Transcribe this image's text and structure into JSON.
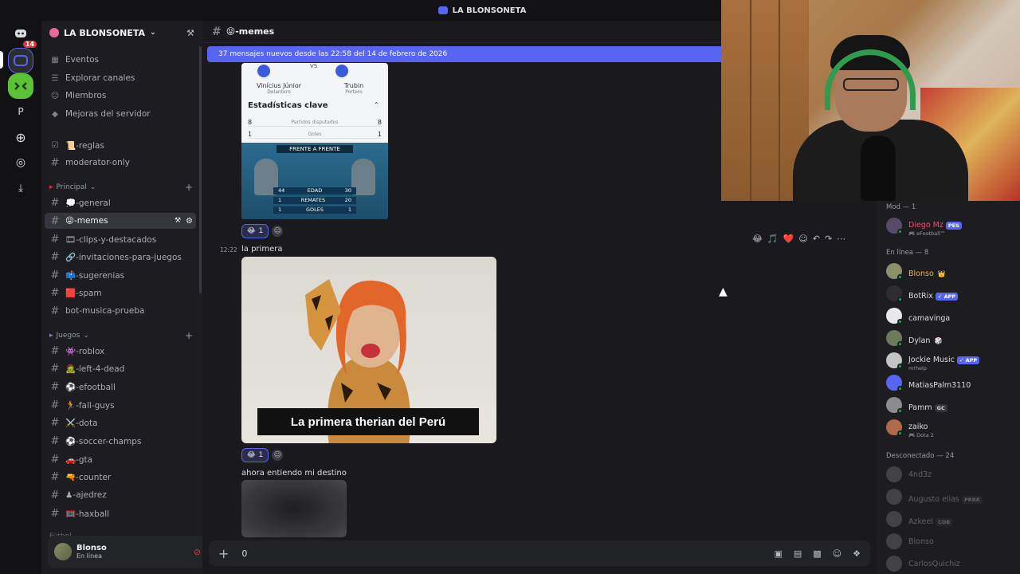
{
  "window": {
    "title": "LA BLONSONETA"
  },
  "rail": {
    "badge": "14",
    "p_label": "P"
  },
  "server": {
    "name": "LA BLONSONETA"
  },
  "sidebar": {
    "top_items": [
      {
        "label": "Eventos"
      },
      {
        "label": "Explorar canales"
      },
      {
        "label": "Miembros"
      },
      {
        "label": "Mejoras del servidor"
      }
    ],
    "pinned_channels": [
      {
        "label": "📜-reglas"
      },
      {
        "label": "moderator-only"
      }
    ],
    "category_principal": "Principal",
    "principal_channels": [
      {
        "label": "💭-general"
      },
      {
        "label": "😝-memes"
      },
      {
        "label": "🎞-clips-y-destacados"
      },
      {
        "label": "🔗-invitaciones-para-juegos"
      },
      {
        "label": "📫-sugerenias"
      },
      {
        "label": "🟥-spam"
      },
      {
        "label": "bot-musica-prueba"
      }
    ],
    "category_juegos": "Juegos",
    "juegos_channels": [
      {
        "label": "👾-roblox"
      },
      {
        "label": "🧟-left-4-dead"
      },
      {
        "label": "⚽-efootball"
      },
      {
        "label": "🏃-fall-guys"
      },
      {
        "label": "⚔️-dota"
      },
      {
        "label": "⚽-soccer-champs"
      },
      {
        "label": "🚗-gta"
      },
      {
        "label": "🔫-counter"
      },
      {
        "label": "♟-ajedrez"
      },
      {
        "label": "🥅-haxball"
      }
    ],
    "category_futbol": "Fútbol"
  },
  "user": {
    "name": "Blonso",
    "status": "En línea"
  },
  "chat": {
    "channel": "😝-memes",
    "new_banner": "37 mensajes nuevos desde las 22:58 del 14 de febrero de 2026",
    "card": {
      "player_left": "Vinícius Júnior",
      "player_left_pos": "Delantero",
      "vs": "VS",
      "player_right": "Trubin",
      "player_right_pos": "Portero",
      "stats_title": "Estadísticas clave",
      "rows": [
        {
          "left": "8",
          "mid": "Partidos disputados",
          "right": "8"
        },
        {
          "left": "1",
          "mid": "Goles",
          "right": "1"
        }
      ],
      "vs_title": "FRENTE A FRENTE",
      "vs_rows": [
        {
          "left": "44",
          "mid": "EDAD",
          "right": "30"
        },
        {
          "left": "1",
          "mid": "REMATES",
          "right": "20"
        },
        {
          "left": "1",
          "mid": "GOLES",
          "right": "1"
        }
      ]
    },
    "reaction1": {
      "emoji": "😂",
      "count": "1"
    },
    "msg2_time": "12:22",
    "msg2_text": "la primera",
    "photo_caption": "La primera therian del Perú",
    "reaction2": {
      "emoji": "😂",
      "count": "1"
    },
    "msg3_text": "ahora entiendo mi destino",
    "hover_emojis": [
      "😂",
      "🎵",
      "❤️"
    ],
    "composer_value": "0"
  },
  "members": {
    "mod_header": "Mod — 1",
    "mod": [
      {
        "name": "Diego Mz",
        "tag": "PES",
        "sub": "🎮 eFootball™",
        "color": "#e84d6b"
      }
    ],
    "online_header": "En línea — 8",
    "online": [
      {
        "name": "Blonso",
        "tag": "",
        "sub": "",
        "suffix": "👑",
        "color": "#f0b232"
      },
      {
        "name": "BotRix",
        "tag": "✓ APP",
        "sub": "",
        "suffix": "",
        "color": "#dbdee1"
      },
      {
        "name": "camavinga",
        "tag": "",
        "sub": "",
        "suffix": "",
        "color": "#dbdee1"
      },
      {
        "name": "Dylan",
        "tag": "",
        "sub": "",
        "suffix": "🎲",
        "color": "#dbdee1"
      },
      {
        "name": "Jockie Music",
        "tag": "✓ APP",
        "sub": "m!help",
        "suffix": "",
        "color": "#dbdee1"
      },
      {
        "name": "MatiasPalm3110",
        "tag": "",
        "sub": "",
        "suffix": "",
        "color": "#dbdee1"
      },
      {
        "name": "Pamm",
        "tag": "GC",
        "sub": "",
        "suffix": "",
        "color": "#dbdee1"
      },
      {
        "name": "zaiko",
        "tag": "",
        "sub": "🎮 Dota 2",
        "suffix": "",
        "color": "#dbdee1"
      }
    ],
    "offline_header": "Desconectado — 24",
    "offline": [
      {
        "name": "4nd3z",
        "tag": ""
      },
      {
        "name": "Augusto elias",
        "tag": "PRRR"
      },
      {
        "name": "Azkeel",
        "tag": "COB"
      },
      {
        "name": "Blonso",
        "tag": ""
      },
      {
        "name": "CarlosQuichiz",
        "tag": ""
      }
    ]
  },
  "colors": {
    "accent": "#5865f2",
    "online": "#23a55a",
    "badge": "#da373c"
  }
}
